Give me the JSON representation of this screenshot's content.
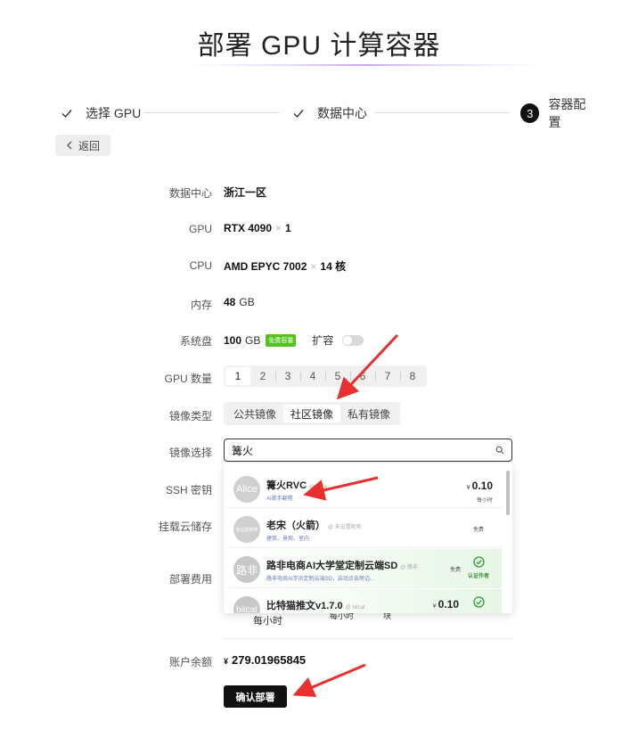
{
  "page": {
    "title": "部署 GPU 计算容器"
  },
  "steps": [
    {
      "label": "选择 GPU",
      "state": "done"
    },
    {
      "label": "数据中心",
      "state": "done"
    },
    {
      "label": "容器配置",
      "state": "current",
      "number": "3"
    }
  ],
  "back_label": "返回",
  "form": {
    "datacenter": {
      "label": "数据中心",
      "value": "浙江一区"
    },
    "gpu": {
      "label": "GPU",
      "model": "RTX 4090",
      "mul": "×",
      "count": "1"
    },
    "cpu": {
      "label": "CPU",
      "model": "AMD EPYC 7002",
      "mul": "×",
      "count": "14 核"
    },
    "memory": {
      "label": "内存",
      "value": "48",
      "unit": "GB"
    },
    "system_disk": {
      "label": "系统盘",
      "value": "100",
      "unit": "GB",
      "badge": "免费容量",
      "expand_label": "扩容",
      "expand_enabled": false
    },
    "gpu_count": {
      "label": "GPU 数量",
      "options": [
        "1",
        "2",
        "3",
        "4",
        "5",
        "6",
        "7",
        "8"
      ],
      "selected": "1"
    },
    "image_type": {
      "label": "镜像类型",
      "options": [
        "公共镜像",
        "社区镜像",
        "私有镜像"
      ],
      "selected": "社区镜像"
    },
    "image_select": {
      "label": "镜像选择",
      "value": "篝火"
    },
    "ssh_key": {
      "label": "SSH 密钥"
    },
    "cloud_storage": {
      "label": "挂载云储存"
    },
    "deploy_fee": {
      "label": "部署费用",
      "partial_texts": [
        "每小时",
        "每小时",
        "块"
      ]
    },
    "balance": {
      "label": "账户余额",
      "currency": "¥",
      "value": "279.01965845"
    }
  },
  "dropdown_items": [
    {
      "avatar": "Alice",
      "name": "篝火RVC",
      "author": "@ Alice",
      "desc": "AI歌手翻唱",
      "currency": "¥",
      "price": "0.10",
      "per": "每小时",
      "certified": false
    },
    {
      "avatar": "未设置昵称",
      "name": "老宋（火箭）",
      "author": "@ 未设置昵称",
      "desc": "建筑、景观、室内",
      "free": "免费",
      "certified": false
    },
    {
      "avatar": "路非",
      "name": "路非电商AI大学堂定制云端SD",
      "author": "@ 路非",
      "desc": "路非电商AI学员定制云端SD，启动点击旁边...",
      "free": "免费",
      "certified": true,
      "cert_label": "认证作者"
    },
    {
      "avatar": "bitcat",
      "name": "比特猫推文v1.7.0",
      "author": "@ bitcat",
      "desc": "",
      "currency": "¥",
      "price": "0.10",
      "certified": true
    }
  ],
  "deploy_button": "确认部署",
  "colors": {
    "accent": "#111111",
    "badge_green": "#52c41a",
    "arrow_red": "#e8312f",
    "cert_green": "#3a8f3a"
  }
}
